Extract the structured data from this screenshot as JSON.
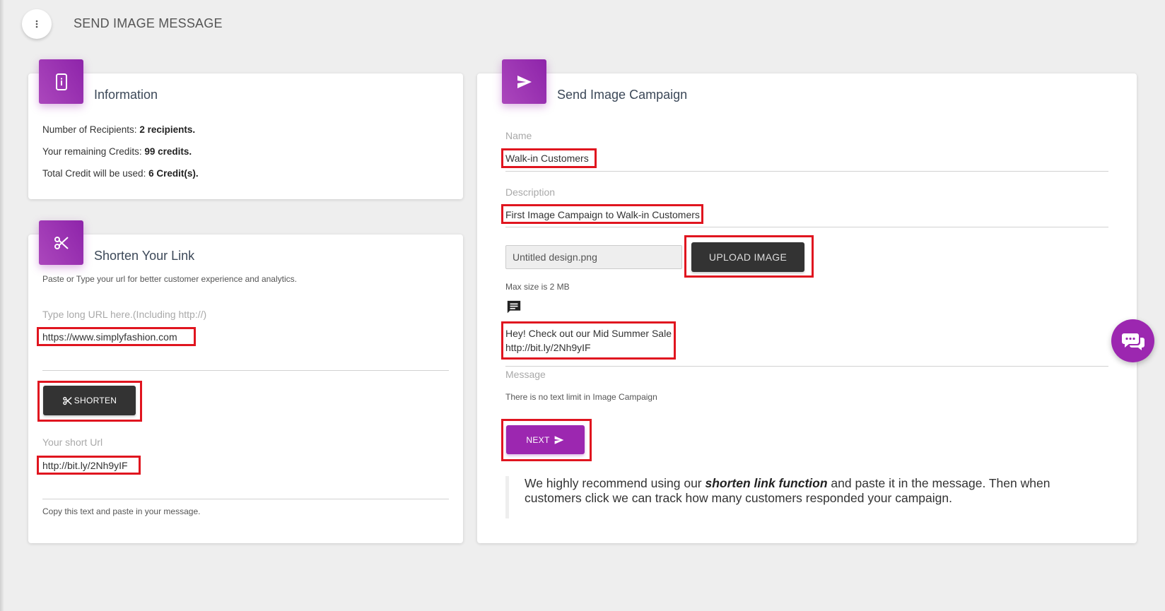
{
  "header": {
    "title": "SEND IMAGE MESSAGE",
    "menu_icon": "dots-vertical-icon"
  },
  "information": {
    "title": "Information",
    "icon": "phone-info-icon",
    "recipients_label": "Number of Recipients: ",
    "recipients_value": "2 recipients.",
    "credits_label": "Your remaining Credits: ",
    "credits_value": "99 credits.",
    "used_label": "Total Credit will be used: ",
    "used_value": "6 Credit(s)."
  },
  "shorten": {
    "title": "Shorten Your Link",
    "icon": "scissors-icon",
    "subtitle": "Paste or Type your url for better customer experience and analytics.",
    "url_label": "Type long URL here.(Including http://)",
    "url_value": "https://www.simplyfashion.com",
    "button_label": "SHORTEN",
    "short_label": "Your short Url",
    "short_value": "http://bit.ly/2Nh9yIF",
    "help": "Copy this text and paste in your message."
  },
  "campaign": {
    "title": "Send Image Campaign",
    "icon": "send-icon",
    "name_label": "Name",
    "name_value": "Walk-in Customers",
    "desc_label": "Description",
    "desc_value": "First Image Campaign to Walk-in Customers",
    "file_name": "Untitled design.png",
    "upload_label": "UPLOAD IMAGE",
    "max_size": "Max size is 2 MB",
    "message_line1": "Hey! Check out our Mid Summer Sale",
    "message_line2": "http://bit.ly/2Nh9yIF",
    "message_label": "Message",
    "message_help": "There is no text limit in Image Campaign",
    "next_label": "NEXT",
    "quote_part1": "We highly recommend using our ",
    "quote_emph": "shorten link function",
    "quote_part2": " and paste it in the message. Then when customers click we can track how many customers responded your campaign."
  },
  "colors": {
    "accent": "#9c27b0",
    "highlight": "#e0151f",
    "dark_button": "#333333"
  }
}
